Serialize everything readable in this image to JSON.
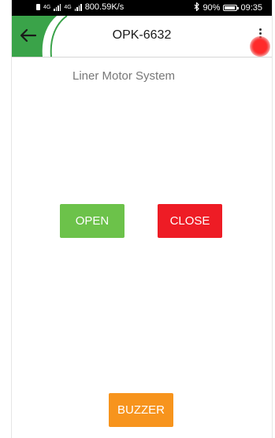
{
  "status_bar": {
    "network_top": "4G",
    "network_bottom": "4G",
    "speed": "800.59K/s",
    "bluetooth_icon": "bluetooth-icon",
    "battery_percent": "90%",
    "battery_level": 0.9,
    "time": "09:35"
  },
  "app_bar": {
    "title": "OPK-6632",
    "back_icon": "arrow-left-icon",
    "menu_icon": "more-vertical-icon",
    "connection_status_color": "#ff2a2a"
  },
  "main": {
    "subtitle": "Liner Motor System",
    "open_label": "OPEN",
    "close_label": "CLOSE",
    "buzzer_label": "BUZZER"
  },
  "colors": {
    "accent_green": "#3aa349",
    "open": "#6cc24a",
    "close": "#ee1c25",
    "buzzer": "#f7941d"
  }
}
